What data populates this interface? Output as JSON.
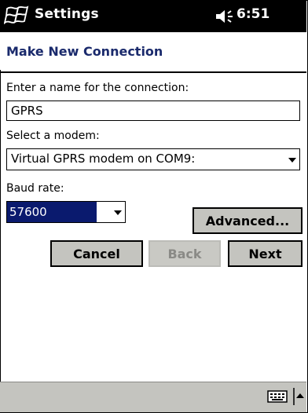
{
  "titlebar": {
    "start_icon": "windows-flag-icon",
    "title": "Settings",
    "volume_icon": "speaker-icon",
    "time": "6:51"
  },
  "heading": {
    "title": "Make New Connection"
  },
  "form": {
    "name_label": "Enter a name for the connection:",
    "name_value": "GPRS",
    "modem_label": "Select a modem:",
    "modem_value": "Virtual GPRS modem on COM9:",
    "baud_label": "Baud rate:",
    "baud_value": "57600"
  },
  "buttons": {
    "advanced": "Advanced...",
    "cancel": "Cancel",
    "back": "Back",
    "next": "Next"
  },
  "bottombar": {
    "keyboard_icon": "keyboard-icon",
    "sip_arrow_icon": "up-arrow-icon"
  },
  "colors": {
    "titlebar_bg": "#000000",
    "heading_text": "#1a2a6c",
    "selection_bg": "#0a1a6e",
    "button_face": "#c4c4bf"
  }
}
